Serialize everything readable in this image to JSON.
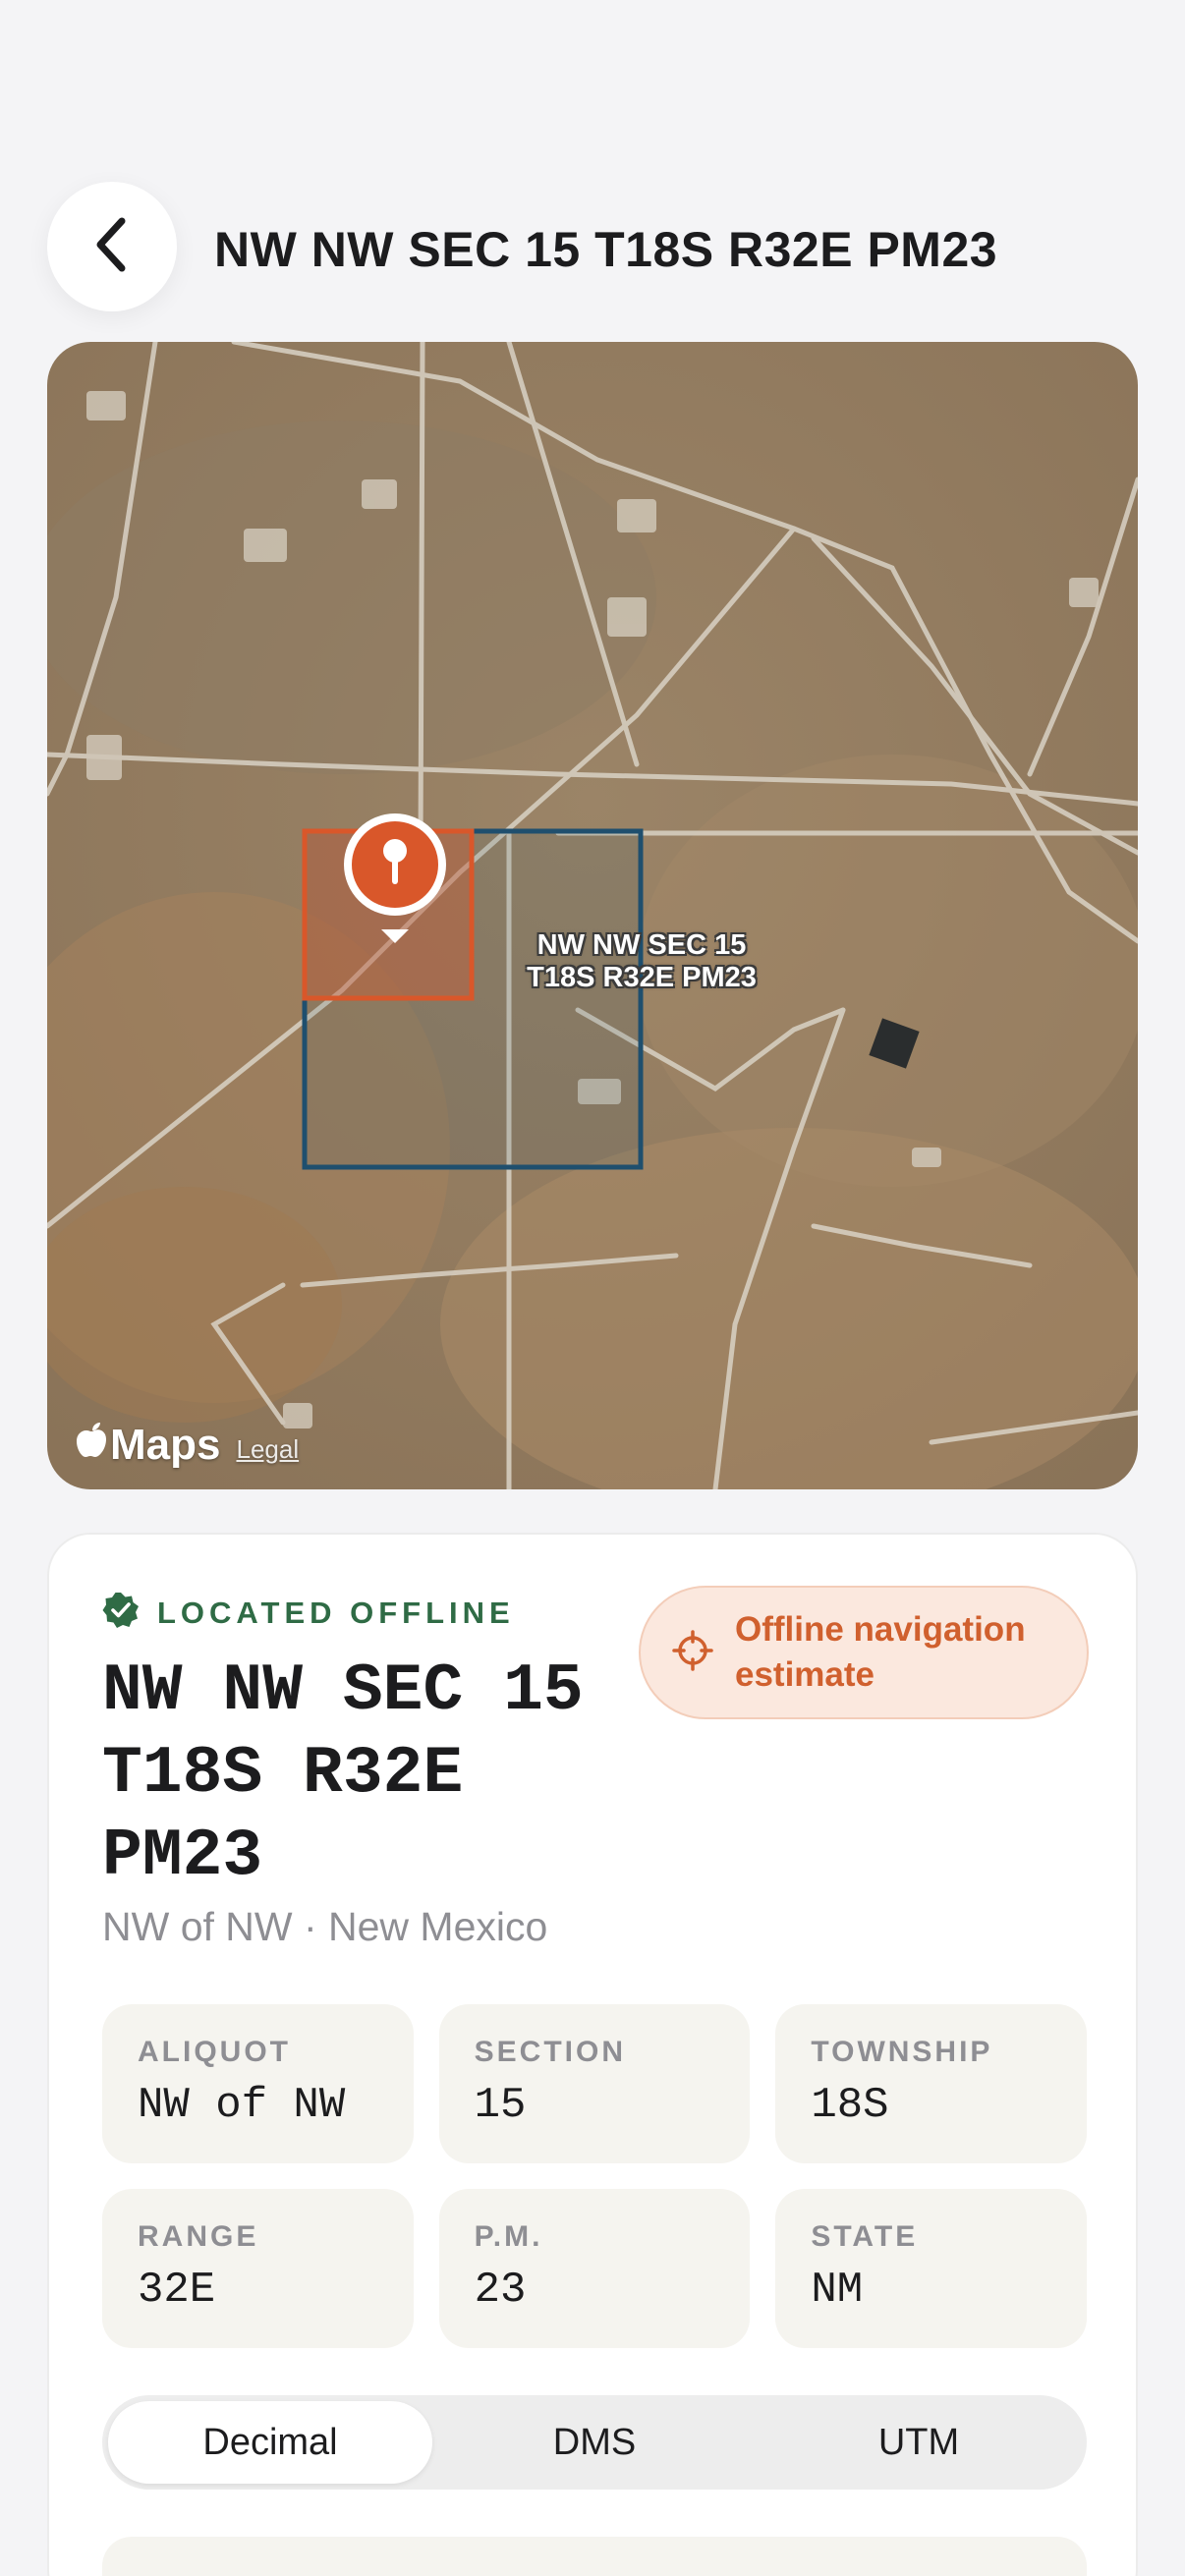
{
  "header": {
    "title": "NW NW SEC 15 T18S R32E PM23",
    "back_icon": "chevron-left-icon"
  },
  "map": {
    "pin_label_line1": "NW NW SEC 15",
    "pin_label_line2": "T18S R32E PM23",
    "brand": "Maps",
    "legal": "Legal",
    "colors": {
      "aliquot_outline": "#d9572a",
      "section_outline": "#1f4f6e",
      "pin": "#d9572a"
    }
  },
  "card": {
    "status": "LOCATED OFFLINE",
    "status_icon": "verified-check-icon",
    "status_color": "#2f6b45",
    "badge": {
      "line1": "Offline navigation",
      "line2": "estimate",
      "icon": "crosshair-icon",
      "color": "#d0602e"
    },
    "description_lines": [
      "NW NW SEC 15",
      "T18S R32E",
      "PM23"
    ],
    "subtitle": "NW of NW · New Mexico",
    "fields": [
      {
        "label": "ALIQUOT",
        "value": "NW of NW"
      },
      {
        "label": "SECTION",
        "value": "15"
      },
      {
        "label": "TOWNSHIP",
        "value": "18S"
      },
      {
        "label": "RANGE",
        "value": "32E"
      },
      {
        "label": "P.M.",
        "value": "23"
      },
      {
        "label": "STATE",
        "value": "NM"
      }
    ],
    "format_tabs": [
      {
        "label": "Decimal",
        "selected": true
      },
      {
        "label": "DMS",
        "selected": false
      },
      {
        "label": "UTM",
        "selected": false
      }
    ]
  }
}
